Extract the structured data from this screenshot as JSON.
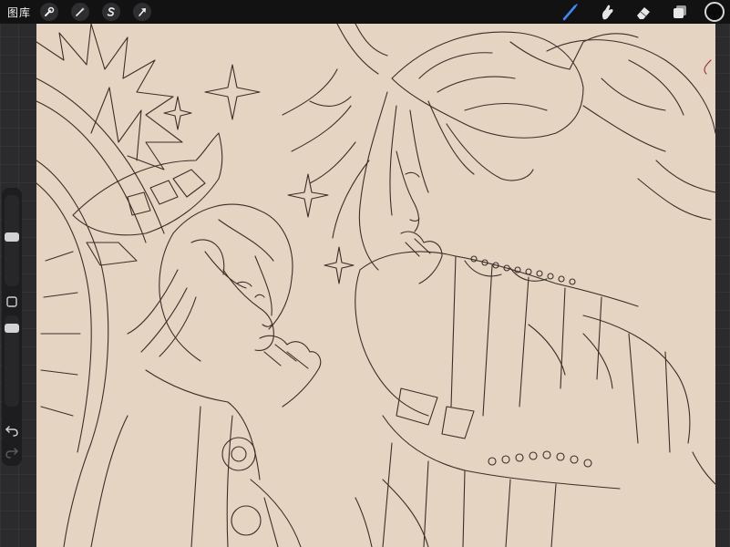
{
  "topbar": {
    "gallery_label": "图库",
    "left_tools": [
      {
        "name": "actions",
        "icon": "wrench-icon"
      },
      {
        "name": "adjustments",
        "icon": "magic-wand-icon"
      },
      {
        "name": "selection",
        "icon": "selection-s-icon"
      },
      {
        "name": "transform",
        "icon": "arrow-cursor-icon"
      }
    ],
    "right_tools": [
      {
        "name": "brush",
        "icon": "brush-icon",
        "active": true,
        "color": "#3d8bff"
      },
      {
        "name": "smudge",
        "icon": "smudge-finger-icon"
      },
      {
        "name": "eraser",
        "icon": "eraser-icon"
      },
      {
        "name": "layers",
        "icon": "layers-icon"
      }
    ],
    "current_color": "#0a0a0a"
  },
  "canvas": {
    "background": "#e6d4c3",
    "line_color": "#3a2f28"
  },
  "sidebar": {
    "brush_size": 0.45,
    "opacity": 0.1
  }
}
